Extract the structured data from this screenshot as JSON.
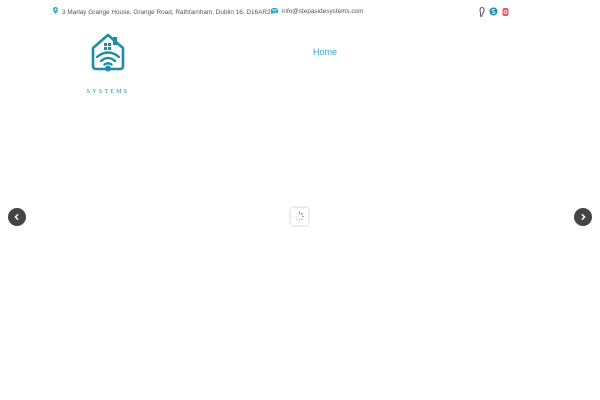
{
  "header": {
    "address": "3 Marlay Grange House, Grange Road, Rathfarnham, Dublin 16, D16AR29",
    "email": "info@stepasidesystems.com",
    "address_icon": "map-pin-icon",
    "email_icon": "envelope-icon",
    "social": [
      {
        "icon": "social-icon-1",
        "color": "#555555"
      },
      {
        "icon": "skype-icon",
        "color": "#1e8ea3"
      },
      {
        "icon": "instagram-icon",
        "color": "#e05a6a"
      }
    ]
  },
  "logo": {
    "text": "SYSTEMS",
    "color": "#1e8ea3"
  },
  "nav": {
    "items": [
      {
        "label": "Home",
        "color": "#35a8d6"
      }
    ]
  },
  "slider": {
    "prev_icon": "chevron-left-icon",
    "next_icon": "chevron-right-icon",
    "loader_icon": "spinner-icon"
  }
}
